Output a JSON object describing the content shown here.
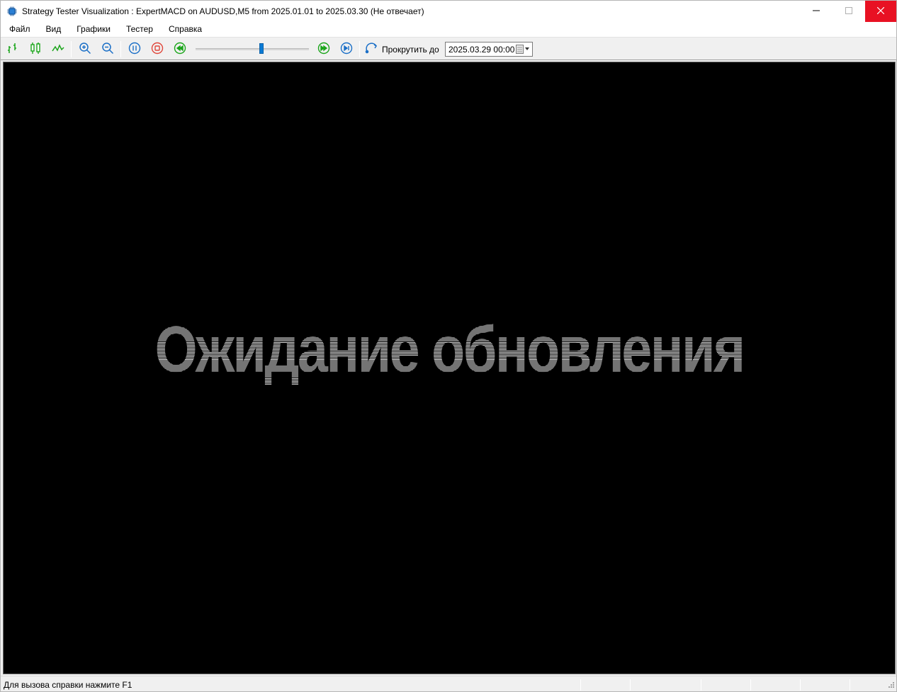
{
  "window": {
    "title": "Strategy Tester Visualization : ExpertMACD on AUDUSD,M5 from 2025.01.01 to 2025.03.30 (Не отвечает)",
    "icons": {
      "app": "chip-icon",
      "minimize": "minimize-icon",
      "maximize": "maximize-icon",
      "close": "close-icon"
    },
    "close_color": "#e81123"
  },
  "menu": {
    "items": [
      {
        "label": "Файл"
      },
      {
        "label": "Вид"
      },
      {
        "label": "Графики"
      },
      {
        "label": "Тестер"
      },
      {
        "label": "Справка"
      }
    ]
  },
  "toolbar": {
    "buttons": [
      {
        "name": "bar-chart-icon"
      },
      {
        "name": "candlestick-chart-icon"
      },
      {
        "name": "line-chart-icon"
      },
      {
        "name": "zoom-in-icon"
      },
      {
        "name": "zoom-out-icon"
      },
      {
        "name": "pause-icon"
      },
      {
        "name": "stop-icon"
      },
      {
        "name": "rewind-icon"
      },
      {
        "name": "fast-forward-icon"
      },
      {
        "name": "skip-to-end-icon"
      },
      {
        "name": "scroll-to-icon"
      }
    ],
    "speed_slider_fraction": 0.58,
    "scroll_to_label": "Прокрутить до",
    "scroll_to_date": "2025.03.29 00:00",
    "accent_color": "#0a7ad4"
  },
  "chart": {
    "background": "#000000",
    "message": "Ожидание обновления"
  },
  "status": {
    "help_text": "Для вызова справки нажмите F1"
  }
}
